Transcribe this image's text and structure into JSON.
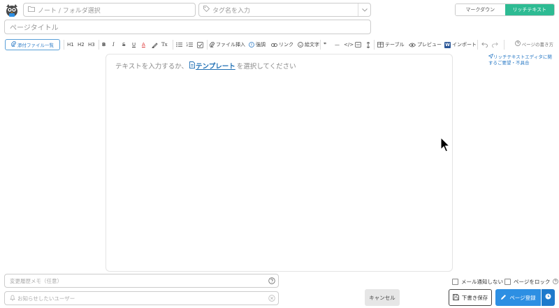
{
  "header": {
    "folder_placeholder": "ノート / フォルダ選択",
    "tag_placeholder": "タグ名を入力",
    "mode_markdown": "マークダウン",
    "mode_richtext": "リッチテキスト",
    "title_placeholder": "ページタイトル"
  },
  "toolbar": {
    "attach_label": "添付ファイル一覧",
    "h1": "H1",
    "h2": "H2",
    "h3": "H3",
    "bold": "B",
    "italic": "I",
    "strike": "S",
    "underline": "U",
    "font_color": "A",
    "clear_format": "Tx",
    "insert_file": "ファイル挿入",
    "emphasis": "強調",
    "link": "リンク",
    "emoji": "絵文字",
    "quote": "❞",
    "hr": "—",
    "code": "</>",
    "table": "テーブル",
    "preview": "プレビュー",
    "import_badge": "W",
    "import": "インポート",
    "help": "ページの書き方"
  },
  "editor": {
    "placeholder_before": "テキストを入力するか、",
    "template_link": "テンプレート",
    "placeholder_after": "を選択してください"
  },
  "side": {
    "feedback": "リッチテキストエディタに関するご要望・不具合"
  },
  "footer": {
    "memo_placeholder": "変更履歴メモ（任意）",
    "notify_placeholder": "お知らせしたいユーザー",
    "cancel": "キャンセル",
    "no_mail": "メール通知しない",
    "lock_page": "ページをロック",
    "draft": "下書き保存",
    "save": "ページ登録"
  },
  "colors": {
    "accent_green": "#2dbb93",
    "accent_blue": "#2d8fe3",
    "link_blue": "#1f6fb4"
  }
}
